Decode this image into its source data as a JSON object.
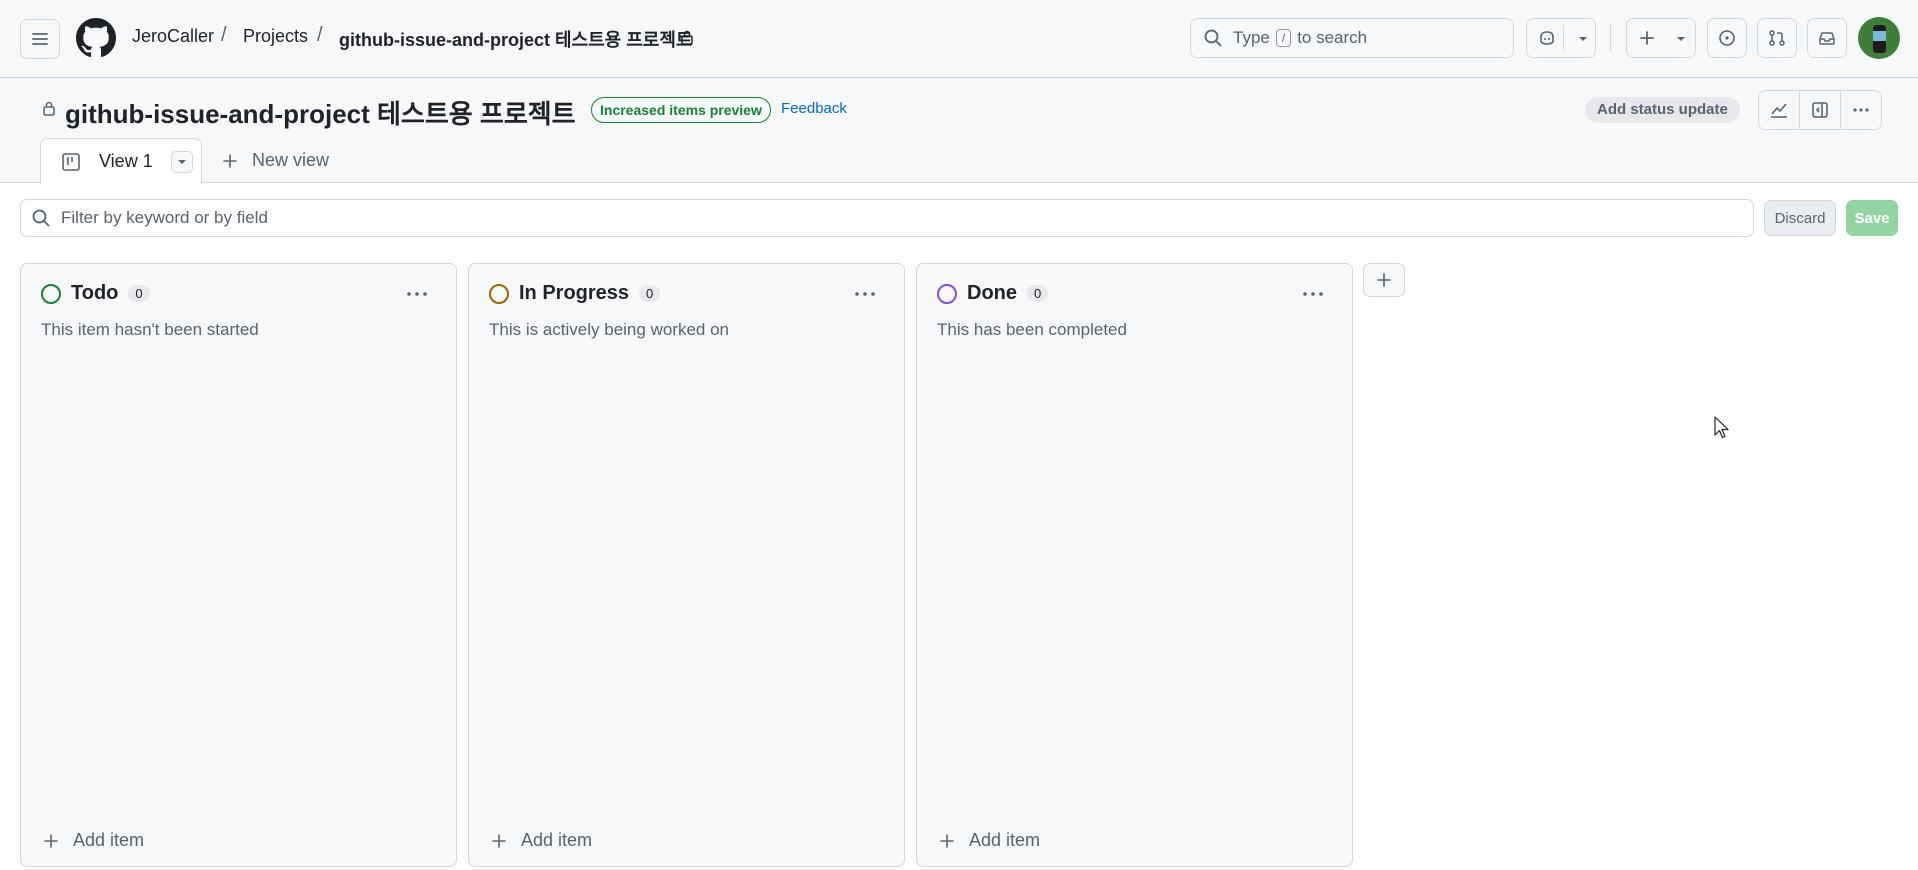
{
  "header": {
    "breadcrumbs": [
      "JeroCaller",
      "Projects",
      "github-issue-and-project 테스트용 프로젝트"
    ],
    "separator": "/",
    "search": {
      "prefix": "Type",
      "key": "/",
      "suffix": "to search"
    }
  },
  "project": {
    "title": "github-issue-and-project 테스트용 프로젝트",
    "preview_badge": "Increased items preview",
    "feedback_link": "Feedback",
    "status_update_button": "Add status update"
  },
  "views": {
    "active_tab": "View 1",
    "new_view": "New view"
  },
  "filter": {
    "placeholder": "Filter by keyword or by field",
    "discard_label": "Discard",
    "save_label": "Save"
  },
  "columns": [
    {
      "title": "Todo",
      "count": "0",
      "description": "This item hasn't been started",
      "add_label": "Add item",
      "color": "#1a7f37"
    },
    {
      "title": "In Progress",
      "count": "0",
      "description": "This is actively being worked on",
      "add_label": "Add item",
      "color": "#9a6700"
    },
    {
      "title": "Done",
      "count": "0",
      "description": "This has been completed",
      "add_label": "Add item",
      "color": "#8250df"
    }
  ],
  "icons": {
    "menu": "hamburger-icon",
    "logo": "github-logo-icon",
    "copilot": "copilot-icon",
    "create": "plus-icon",
    "issues": "issue-opened-icon",
    "pulls": "git-pull-request-icon",
    "inbox": "inbox-icon",
    "insights": "graph-icon",
    "sidepanel": "sidebar-expand-icon"
  }
}
